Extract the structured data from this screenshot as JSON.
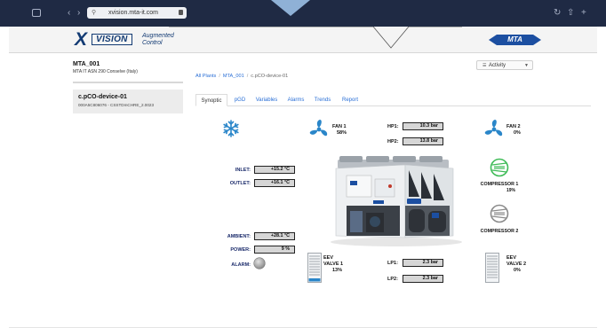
{
  "browser": {
    "url": "xvision.mta-it.com"
  },
  "header": {
    "logo_text": "VISION",
    "logo_sub_1": "Augmented",
    "logo_sub_2": "Control",
    "brand": "MTA"
  },
  "unit": {
    "name": "MTA_001",
    "description": "MTA IT ASN 290 Conselve (Italy)"
  },
  "device": {
    "name": "c.pCO-device-01",
    "description": "000A5C806076 - CSSTDmCHRE_2.0023"
  },
  "breadcrumb": [
    "All Plants",
    "MTA_001",
    "c.pCO-device-01"
  ],
  "activity": {
    "label": "Activity",
    "icon": "list-icon"
  },
  "tabs": [
    "Synoptic",
    "pGD",
    "Variables",
    "Alarms",
    "Trends",
    "Report"
  ],
  "active_tab": "Synoptic",
  "synoptic": {
    "fan1": {
      "label": "FAN 1",
      "value": "58%"
    },
    "fan2": {
      "label": "FAN 2",
      "value": "0%"
    },
    "hp1": {
      "label": "HP1:",
      "value": "10.3 bar"
    },
    "hp2": {
      "label": "HP2:",
      "value": "13.8 bar"
    },
    "inlet": {
      "label": "INLET:",
      "value": "+15.2 °C"
    },
    "outlet": {
      "label": "OUTLET:",
      "value": "+16.1 °C"
    },
    "ambient": {
      "label": "AMBIENT:",
      "value": "+28.1 °C"
    },
    "power": {
      "label": "POWER:",
      "value": "9 %"
    },
    "alarm": {
      "label": "ALARM:"
    },
    "compressor1": {
      "label": "COMPRESSOR 1",
      "value": "19%"
    },
    "compressor2": {
      "label": "COMPRESSOR 2"
    },
    "eev1": {
      "label_1": "EEV",
      "label_2": "VALVE 1",
      "value": "13%"
    },
    "eev2": {
      "label_1": "EEV",
      "label_2": "VALVE 2",
      "value": "0%"
    },
    "lp1": {
      "label": "LP1:",
      "value": "2.3 bar"
    },
    "lp2": {
      "label": "LP2:",
      "value": "2.3 bar"
    }
  },
  "colors": {
    "fan_blue": "#2a86c9",
    "compressor_green": "#3dbb56",
    "compressor_grey": "#8a8a8a",
    "link_blue": "#2a6fd6",
    "navy_label": "#1b2b6b"
  }
}
